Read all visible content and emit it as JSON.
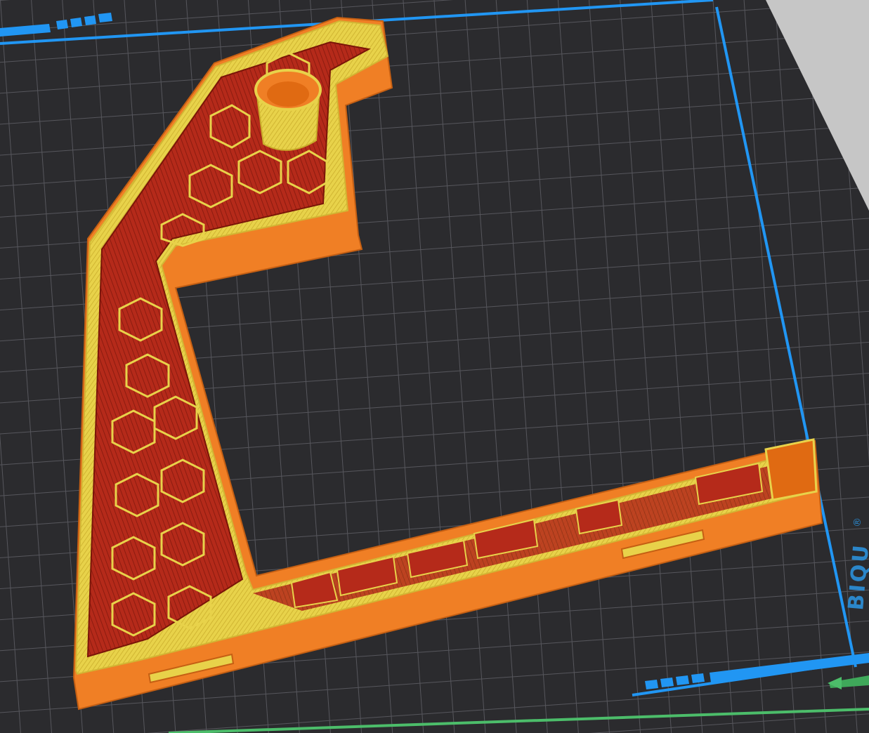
{
  "viewport": {
    "mode": "preview",
    "bed_brand": "BIQU",
    "bed_trademark": "®",
    "colors": {
      "background": "#3b3b3d",
      "bed_surface": "#2a2a2c",
      "grid_line": "#55555a",
      "bed_border": "#2196f3",
      "outer_wall": "#f07f25",
      "inner_wall": "#e8d24a",
      "infill": "#b52a1a",
      "axis_x": "#4cbd6a",
      "margin_wedge": "#c4c4c4"
    },
    "icons": [
      "x-axis-arrow-icon",
      "biqu-logo-icon"
    ]
  }
}
